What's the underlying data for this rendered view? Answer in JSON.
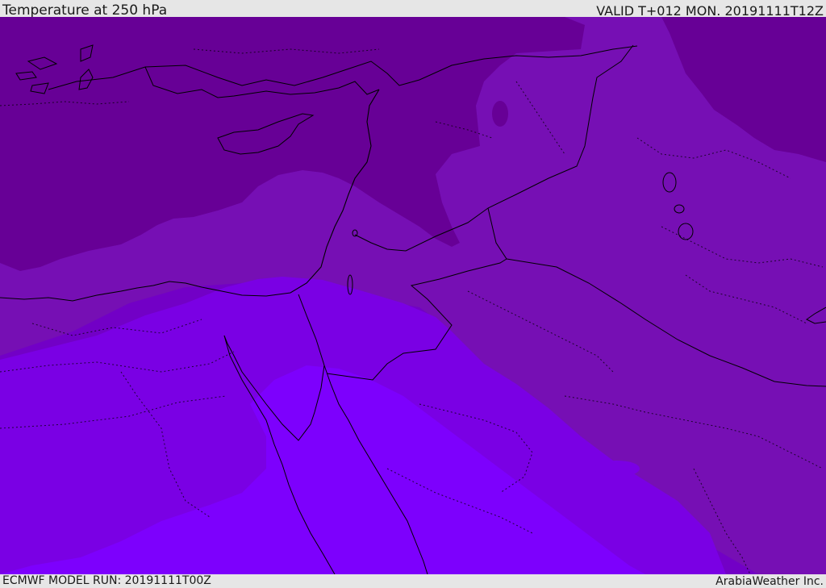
{
  "header": {
    "title": "Temperature at 250 hPa",
    "valid_time": "VALID T+012 MON. 20191111T12Z"
  },
  "footer": {
    "model_run": "ECMWF MODEL RUN: 20191111T00Z",
    "credit": "ArabiaWeather Inc."
  },
  "map": {
    "variable": "Temperature at 250 hPa",
    "fill_colors": {
      "coldest": "#670096",
      "cold": "#760fb4",
      "mid": "#7200c6",
      "warm": "#7a00e4",
      "warmest": "#7d00fd"
    },
    "coastline_color": "#000000",
    "border_style": "dotted"
  }
}
